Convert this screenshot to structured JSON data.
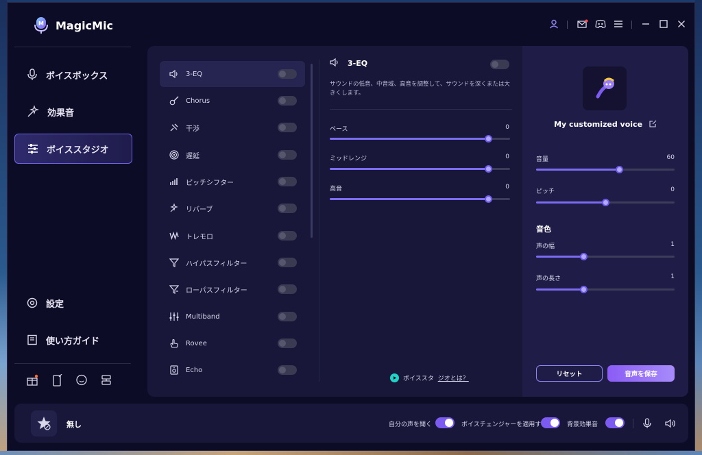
{
  "app": {
    "name": "MagicMic"
  },
  "colors": {
    "accent": "#7c6cf2",
    "background": "#0d0c26",
    "panel": "#18173a",
    "save_button": "#a78bfa"
  },
  "titlebar_icons": [
    "user-icon",
    "mail-icon",
    "discord-icon",
    "menu-icon",
    "minimize-icon",
    "maximize-icon",
    "close-icon"
  ],
  "sidebar": {
    "items": [
      {
        "label": "ボイスボックス",
        "icon": "microphone-icon"
      },
      {
        "label": "効果音",
        "icon": "sparkle-wand-icon"
      },
      {
        "label": "ボイススタジオ",
        "icon": "sliders-icon",
        "active": true
      }
    ],
    "bottom_items": [
      {
        "label": "設定",
        "icon": "settings-icon"
      },
      {
        "label": "使い方ガイド",
        "icon": "guide-book-icon"
      }
    ],
    "mini_icons": [
      "gift-box-icon",
      "mobile-icon",
      "chat-bubble-icon",
      "feedback-icon"
    ]
  },
  "effects": [
    {
      "label": "3-EQ",
      "icon": "speaker-icon",
      "enabled": false,
      "active": true
    },
    {
      "label": "Chorus",
      "icon": "guitar-icon",
      "enabled": false
    },
    {
      "label": "干渉",
      "icon": "satellite-icon",
      "enabled": false
    },
    {
      "label": "遅延",
      "icon": "delay-icon",
      "enabled": false
    },
    {
      "label": "ピッチシフター",
      "icon": "bars-icon",
      "enabled": false
    },
    {
      "label": "リバーブ",
      "icon": "reverb-icon",
      "enabled": false
    },
    {
      "label": "トレモロ",
      "icon": "wave-icon",
      "enabled": false
    },
    {
      "label": "ハイパスフィルター",
      "icon": "highpass-icon",
      "enabled": false
    },
    {
      "label": "ローパスフィルター",
      "icon": "lowpass-icon",
      "enabled": false
    },
    {
      "label": "Multiband",
      "icon": "multiband-icon",
      "enabled": false
    },
    {
      "label": "Rovee",
      "icon": "hand-icon",
      "enabled": false
    },
    {
      "label": "Echo",
      "icon": "echo-icon",
      "enabled": false
    }
  ],
  "eq": {
    "title": "3-EQ",
    "enabled": false,
    "description": "サウンドの低音、中音域、高音を調整して、サウンドを深くまたは大きくします。",
    "sliders": [
      {
        "label": "ベース",
        "value": "0",
        "fill": 0.88
      },
      {
        "label": "ミッドレンジ",
        "value": "0",
        "fill": 0.88
      },
      {
        "label": "高音",
        "value": "0",
        "fill": 0.88
      }
    ],
    "studio_link_prefix": "ボイススタ",
    "studio_link": "ジオとは？"
  },
  "voice": {
    "name": "My customized voice",
    "sliders": [
      {
        "label": "音量",
        "value": "60",
        "fill": 0.6
      },
      {
        "label": "ピッチ",
        "value": "0",
        "fill": 0.5
      }
    ],
    "timbre_title": "音色",
    "timbre_sliders": [
      {
        "label": "声の幅",
        "value": "1",
        "fill": 0.34
      },
      {
        "label": "声の長さ",
        "value": "1",
        "fill": 0.34
      }
    ],
    "reset_label": "リセット",
    "save_label": "音声を保存"
  },
  "footer": {
    "current_voice": "無し",
    "toggles": [
      {
        "label": "自分の声を聞く",
        "on": true
      },
      {
        "label": "ボイスチェンジャーを適用する",
        "on": true
      },
      {
        "label": "背景効果音",
        "on": true
      }
    ]
  }
}
